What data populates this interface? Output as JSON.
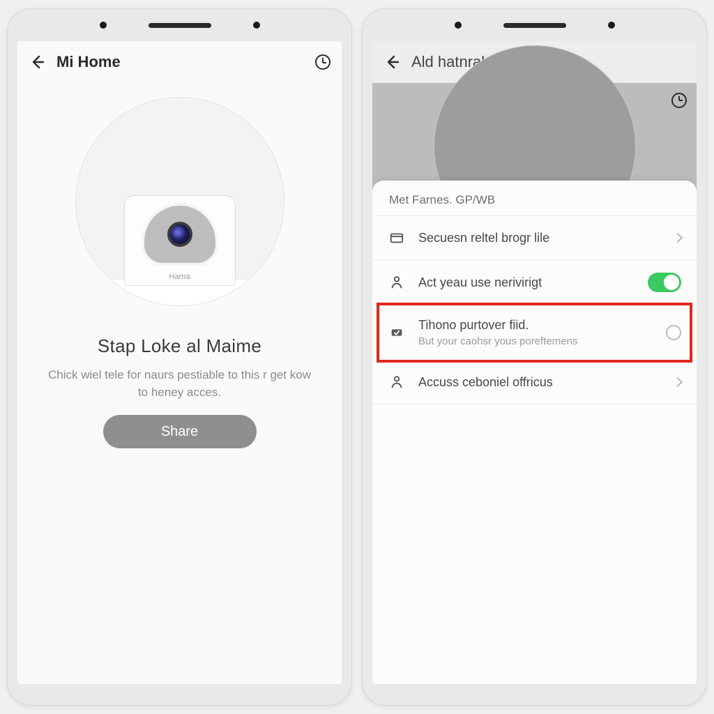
{
  "left": {
    "header": {
      "title": "Mi Home"
    },
    "camera_brand": "Harna",
    "hero_title": "Stap Loke al Maime",
    "hero_desc": "Chick wiel tele for naurs pestiable to this r get kow to heney acces.",
    "share_label": "Share"
  },
  "right": {
    "header": {
      "title": "Ald hatnral clatiden"
    },
    "sheet_header": "Met Farnes. GP/WB",
    "rows": [
      {
        "title": "Secuesn reltel brogr lile"
      },
      {
        "title": "Act yeau use nerivirigt"
      },
      {
        "title": "Tihono purtover fiid.",
        "sub": "But your caohsr yous poreftemens"
      },
      {
        "title": "Accuss ceboniel offricus"
      }
    ]
  },
  "colors": {
    "highlight": "#e3271f",
    "toggle_on": "#3bc962"
  }
}
